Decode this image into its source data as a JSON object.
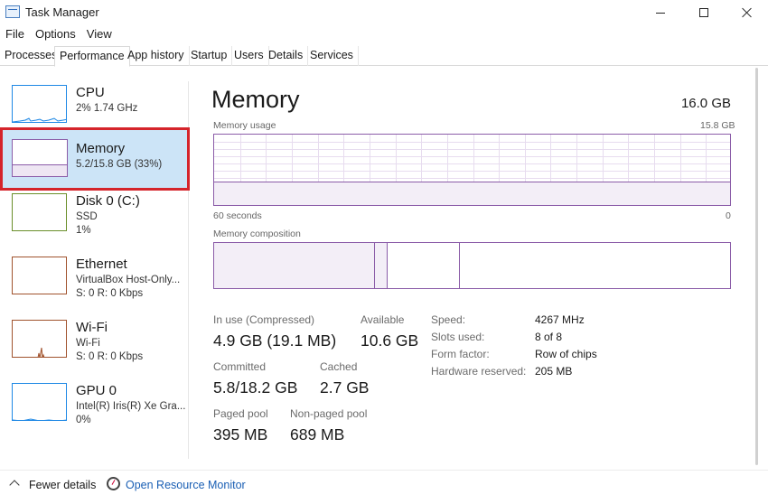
{
  "window": {
    "title": "Task Manager"
  },
  "menu": [
    "File",
    "Options",
    "View"
  ],
  "tabs": [
    "Processes",
    "Performance",
    "App history",
    "Startup",
    "Users",
    "Details",
    "Services"
  ],
  "active_tab": "Performance",
  "sidebar": {
    "items": [
      {
        "title": "CPU",
        "line1": "2%  1.74 GHz",
        "line2": "",
        "color": "#1e88e5",
        "icon": "cpu-graph-icon"
      },
      {
        "title": "Memory",
        "line1": "5.2/15.8 GB (33%)",
        "line2": "",
        "color": "#8b5ca8",
        "icon": "memory-graph-icon",
        "selected": true,
        "usage_fraction": 0.33
      },
      {
        "title": "Disk 0 (C:)",
        "line1": "SSD",
        "line2": "1%",
        "color": "#6a8f2a",
        "icon": "disk-graph-icon"
      },
      {
        "title": "Ethernet",
        "line1": "VirtualBox Host-Only...",
        "line2": "S: 0  R: 0 Kbps",
        "color": "#a0522d",
        "icon": "ethernet-graph-icon"
      },
      {
        "title": "Wi-Fi",
        "line1": "Wi-Fi",
        "line2": "S: 0  R: 0 Kbps",
        "color": "#a0522d",
        "icon": "wifi-graph-icon"
      },
      {
        "title": "GPU 0",
        "line1": "Intel(R) Iris(R) Xe Gra...",
        "line2": "0%",
        "color": "#1e88e5",
        "icon": "gpu-graph-icon"
      }
    ]
  },
  "main": {
    "title": "Memory",
    "total": "16.0 GB",
    "usage_label": "Memory usage",
    "usage_max": "15.8 GB",
    "time_left": "60 seconds",
    "time_right": "0",
    "composition_label": "Memory composition",
    "usage_fraction": 0.33,
    "composition_fractions": {
      "in_use": 0.31,
      "modified": 0.025,
      "standby": 0.14
    },
    "stats": {
      "in_use_label": "In use (Compressed)",
      "in_use_value": "4.9 GB (19.1 MB)",
      "available_label": "Available",
      "available_value": "10.6 GB",
      "committed_label": "Committed",
      "committed_value": "5.8/18.2 GB",
      "cached_label": "Cached",
      "cached_value": "2.7 GB",
      "paged_label": "Paged pool",
      "paged_value": "395 MB",
      "nonpaged_label": "Non-paged pool",
      "nonpaged_value": "689 MB"
    },
    "specs": {
      "speed_label": "Speed:",
      "speed_value": "4267 MHz",
      "slots_label": "Slots used:",
      "slots_value": "8 of 8",
      "form_label": "Form factor:",
      "form_value": "Row of chips",
      "reserved_label": "Hardware reserved:",
      "reserved_value": "205 MB"
    }
  },
  "footer": {
    "fewer_details": "Fewer details",
    "open_monitor": "Open Resource Monitor"
  },
  "colors": {
    "memory_accent": "#8b5ca8",
    "selection_bg": "#cce4f7",
    "highlight_border": "#d5242b",
    "link": "#1a5fb4"
  }
}
